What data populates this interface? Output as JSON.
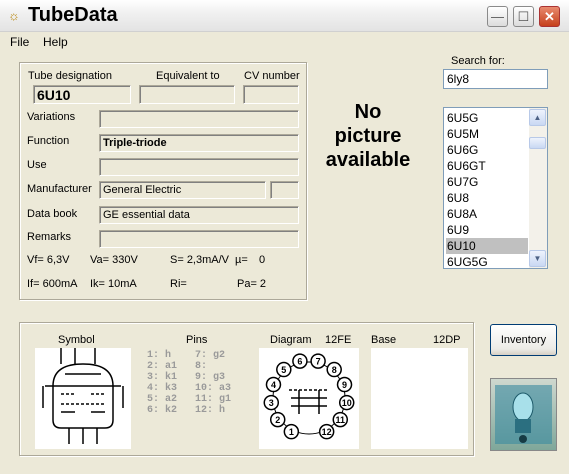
{
  "window": {
    "title": "TubeData"
  },
  "menu": {
    "file": "File",
    "help": "Help"
  },
  "search": {
    "label": "Search for:",
    "value": "6ly8"
  },
  "tube_list": [
    "6U5G",
    "6U5M",
    "6U6G",
    "6U6GT",
    "6U7G",
    "6U8",
    "6U8A",
    "6U9",
    "6U10",
    "6UG5G"
  ],
  "tube_list_selected": "6U10",
  "fields": {
    "designation_label": "Tube designation",
    "designation": "6U10",
    "equivalent_label": "Equivalent to",
    "equivalent": "",
    "cv_label": "CV number",
    "cv": "",
    "variations_label": "Variations",
    "variations": "",
    "function_label": "Function",
    "function": "Triple-triode",
    "use_label": "Use",
    "use": "",
    "manufacturer_label": "Manufacturer",
    "manufacturer": "General Electric",
    "manufacturer_extra": "",
    "databook_label": "Data book",
    "databook": "GE essential data",
    "remarks_label": "Remarks",
    "remarks": ""
  },
  "params": {
    "vf": "Vf= 6,3V",
    "va": "Va= 330V",
    "s": "S= 2,3mA/V",
    "mu": "µ=",
    "mu_val": "0",
    "if": "If= 600mA",
    "ik": "Ik= 10mA",
    "ri": "Ri=",
    "pa": "Pa= 2"
  },
  "no_picture": [
    "No",
    "picture",
    "available"
  ],
  "bottom": {
    "symbol_label": "Symbol",
    "pins_label": "Pins",
    "diagram_label": "Diagram",
    "diagram_code": "12FE",
    "base_label": "Base",
    "base_code": "12DP",
    "pins_left": [
      "1: h",
      "2: a1",
      "3: k1",
      "4: k3",
      "5: a2",
      "6: k2"
    ],
    "pins_right": [
      "7: g2",
      "8:",
      "9: g3",
      "10: a3",
      "11: g1",
      "12: h"
    ],
    "diagram_pins": [
      "1",
      "2",
      "3",
      "4",
      "5",
      "6",
      "7",
      "8",
      "9",
      "10",
      "11",
      "12"
    ]
  },
  "inventory_button": "Inventory",
  "colors": {
    "window_bg": "#ece9d8",
    "close_btn": "#c6401c",
    "list_selection": "#c0c0c0"
  },
  "icons": {
    "app": "lightbulb-icon",
    "minimize": "minimize-icon",
    "maximize": "maximize-icon",
    "close": "close-icon",
    "logo": "tube-logo-icon"
  }
}
